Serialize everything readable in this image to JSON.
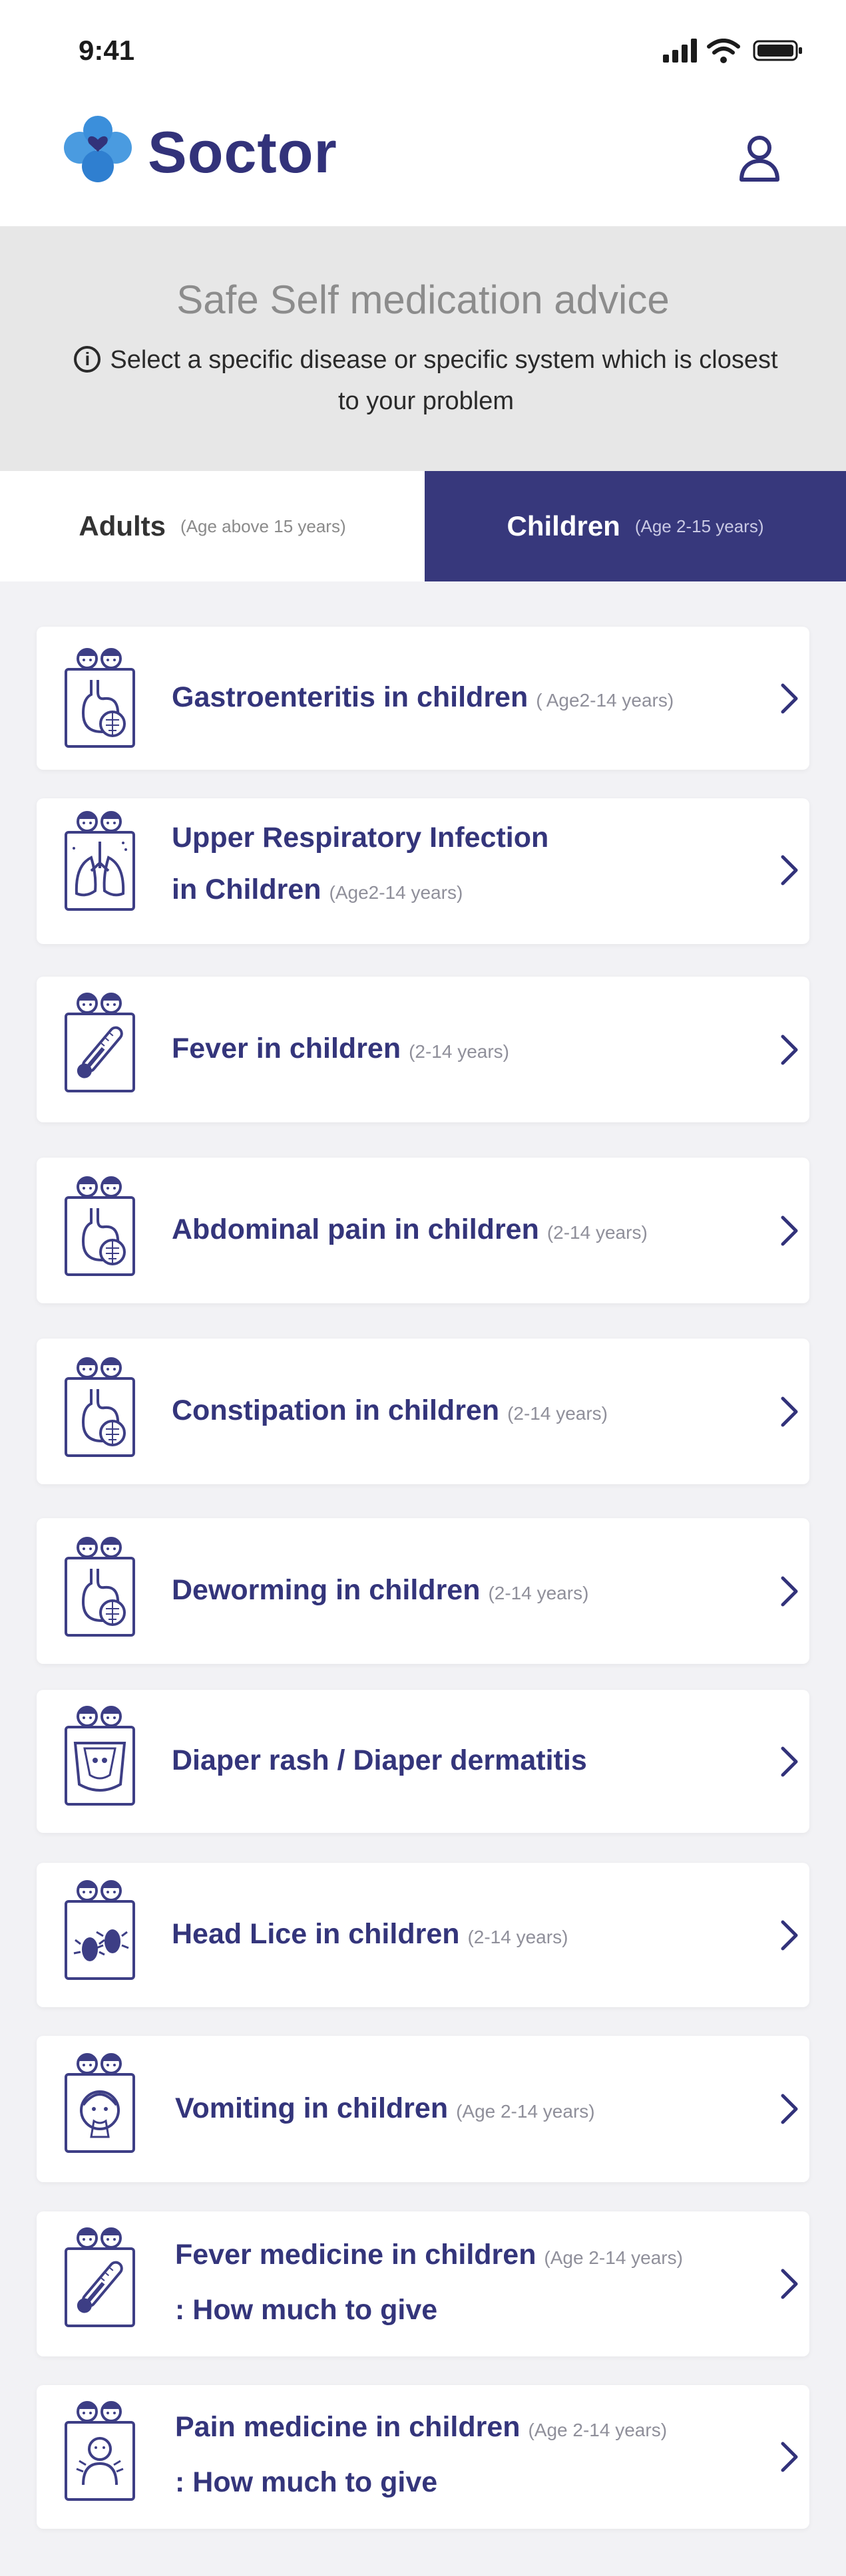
{
  "status_bar": {
    "time": "9:41"
  },
  "header": {
    "brand": "Soctor"
  },
  "banner": {
    "title": "Safe Self  medication advice",
    "info_line1": "Select a specific disease or specific system which is closest",
    "info_line2": "to your problem"
  },
  "tabs": {
    "adults": {
      "label": "Adults",
      "sub": "(Age above 15 years)"
    },
    "children": {
      "label": "Children",
      "sub": "(Age 2-15 years)",
      "selected": true
    }
  },
  "items": [
    {
      "title": "Gastroenteritis in children",
      "age": "( Age2-14 years)",
      "icon": "stomach-icon"
    },
    {
      "title1": "Upper Respiratory Infection",
      "title2": "in Children",
      "age": "(Age2-14 years)",
      "icon": "lungs-icon"
    },
    {
      "title": "Fever in children",
      "age": "(2-14 years)",
      "icon": "thermometer-icon"
    },
    {
      "title": "Abdominal pain in children",
      "age": "(2-14 years)",
      "icon": "stomach-icon"
    },
    {
      "title": "Constipation in children",
      "age": "(2-14 years)",
      "icon": "stomach-icon"
    },
    {
      "title": "Deworming in children",
      "age": "(2-14 years)",
      "icon": "stomach-icon"
    },
    {
      "title": "Diaper rash / Diaper dermatitis",
      "age": "",
      "icon": "diaper-icon"
    },
    {
      "title": "Head Lice in children",
      "age": "(2-14 years)",
      "icon": "lice-icon"
    },
    {
      "title": "Vomiting in children",
      "age": "(Age 2-14 years)",
      "icon": "vomiting-icon"
    },
    {
      "title1": "Fever medicine in children",
      "title2": ": How much to give",
      "age": "(Age 2-14 years)",
      "icon": "thermometer-icon"
    },
    {
      "title1": "Pain medicine in children",
      "title2": ": How much to give",
      "age": "(Age 2-14 years)",
      "icon": "pain-icon"
    }
  ],
  "colors": {
    "primary": "#37387c",
    "text": "#34357b",
    "banner_bg": "#e7e7e7",
    "logo_blue": "#4a9be0"
  }
}
